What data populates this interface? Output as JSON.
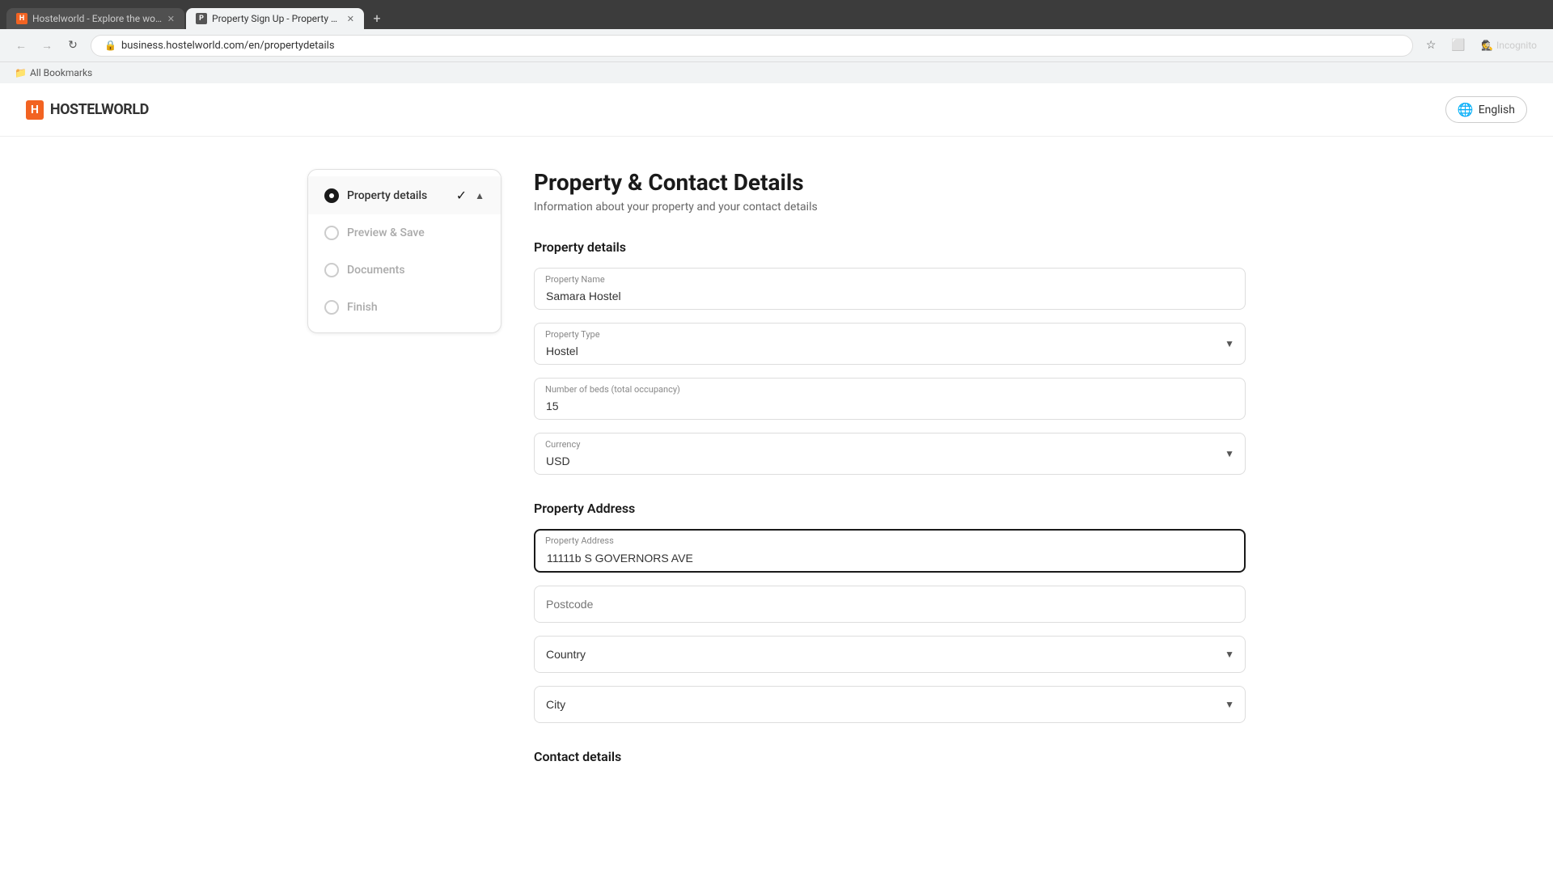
{
  "browser": {
    "tabs": [
      {
        "id": "tab1",
        "favicon": "H",
        "title": "Hostelworld - Explore the worl...",
        "active": false,
        "closeable": true
      },
      {
        "id": "tab2",
        "favicon": "P",
        "title": "Property Sign Up - Property an...",
        "active": true,
        "closeable": true
      }
    ],
    "url": "business.hostelworld.com/en/propertydetails",
    "incognito_label": "Incognito",
    "bookmarks_label": "All Bookmarks"
  },
  "header": {
    "logo_box": "H",
    "logo_text": "HOSTELWORLD",
    "lang_label": "English"
  },
  "sidebar": {
    "items": [
      {
        "id": "property-details",
        "label": "Property details",
        "state": "active",
        "has_check": true
      },
      {
        "id": "preview-save",
        "label": "Preview & Save",
        "state": "inactive"
      },
      {
        "id": "documents",
        "label": "Documents",
        "state": "inactive"
      },
      {
        "id": "finish",
        "label": "Finish",
        "state": "inactive"
      }
    ]
  },
  "form": {
    "page_title": "Property & Contact Details",
    "page_subtitle": "Information about your property and your contact details",
    "property_details_section": "Property details",
    "fields": {
      "property_name_label": "Property Name",
      "property_name_value": "Samara Hostel",
      "property_type_label": "Property Type",
      "property_type_value": "Hostel",
      "beds_label": "Number of beds (total occupancy)",
      "beds_value": "15",
      "currency_label": "Currency",
      "currency_value": "USD"
    },
    "address_section": "Property Address",
    "address_fields": {
      "address_label": "Property Address",
      "address_value": "11111b S GOVERNORS AVE",
      "postcode_label": "Postcode",
      "postcode_value": "",
      "country_label": "Country",
      "country_value": "",
      "city_label": "City",
      "city_value": ""
    },
    "contact_section": "Contact details"
  }
}
